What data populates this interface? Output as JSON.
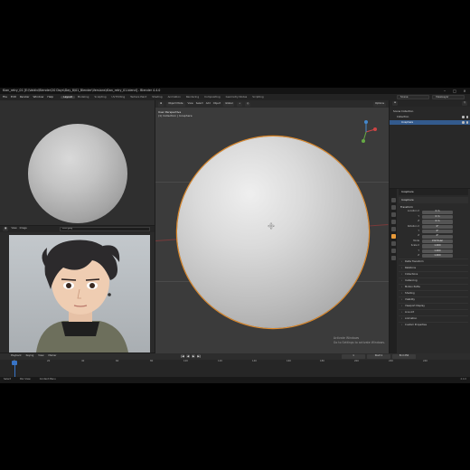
{
  "window": {
    "title": "Kian_retry_01 [E:\\Vaidiv\\Blender\\20 Days\\Day_8\\01_Blender\\Versions\\Kian_retry_01.blend] - Blender 4.4.0"
  },
  "menubar": {
    "items": [
      "File",
      "Edit",
      "Render",
      "Window",
      "Help"
    ],
    "workspaces": [
      "Layout",
      "Modeling",
      "Sculpting",
      "UV Editing",
      "Texture Paint",
      "Shading",
      "Animation",
      "Rendering",
      "Compositing",
      "Geometry Nodes",
      "Scripting"
    ],
    "active_workspace": "Layout",
    "scene_label": "Scene",
    "view_layer_label": "ViewLayer"
  },
  "image_editor": {
    "view_label": "View",
    "image_label": "Image",
    "path": "Kian.jpeg"
  },
  "viewport": {
    "mode_label": "Object Mode",
    "view_menu": "View",
    "select_menu": "Select",
    "add_menu": "Add",
    "object_menu": "Object",
    "transform_label": "Global",
    "options_label": "Options",
    "overlay_title": "User Perspective",
    "overlay_sub": "(1) Collection | Icosphere",
    "watermark_1": "Activate Windows",
    "watermark_2": "Go to Settings to activate Windows."
  },
  "outliner": {
    "root": "Scene Collection",
    "collection": "Collection",
    "object": "Icosphere"
  },
  "properties": {
    "object_name": "Icosphere",
    "data_name": "Icosphere",
    "transform_header": "Transform",
    "rows": [
      {
        "label": "Location X",
        "value": "0 m"
      },
      {
        "label": "Y",
        "value": "0 m"
      },
      {
        "label": "Z",
        "value": "0 m"
      },
      {
        "label": "Rotation X",
        "value": "0°"
      },
      {
        "label": "Y",
        "value": "0°"
      },
      {
        "label": "Z",
        "value": "0°"
      },
      {
        "label": "Mode",
        "value": "XYZ Euler"
      },
      {
        "label": "Scale X",
        "value": "1.000"
      },
      {
        "label": "Y",
        "value": "1.000"
      },
      {
        "label": "Z",
        "value": "1.000"
      }
    ],
    "panels": [
      "Delta Transform",
      "Relations",
      "Collections",
      "Instancing",
      "Motion Paths",
      "Shading",
      "Visibility",
      "Viewport Display",
      "Line Art",
      "Animation",
      "Custom Properties"
    ]
  },
  "timeline": {
    "playback_label": "Playback",
    "keying_label": "Keying",
    "view_label": "View",
    "marker_label": "Marker",
    "current_frame": "1",
    "start_label": "Start",
    "start_value": "1",
    "end_label": "End",
    "end_value": "250",
    "ruler": [
      "0",
      "20",
      "40",
      "60",
      "80",
      "100",
      "120",
      "140",
      "160",
      "180",
      "200",
      "220",
      "240"
    ]
  },
  "statusbar": {
    "select": "Select",
    "pan_view": "Pan View",
    "context_menu": "Context Menu",
    "version": "4.4.0"
  },
  "colors": {
    "selection_outline": "#e08a2a",
    "active_blue": "#335a8d",
    "playhead": "#3874c6"
  }
}
